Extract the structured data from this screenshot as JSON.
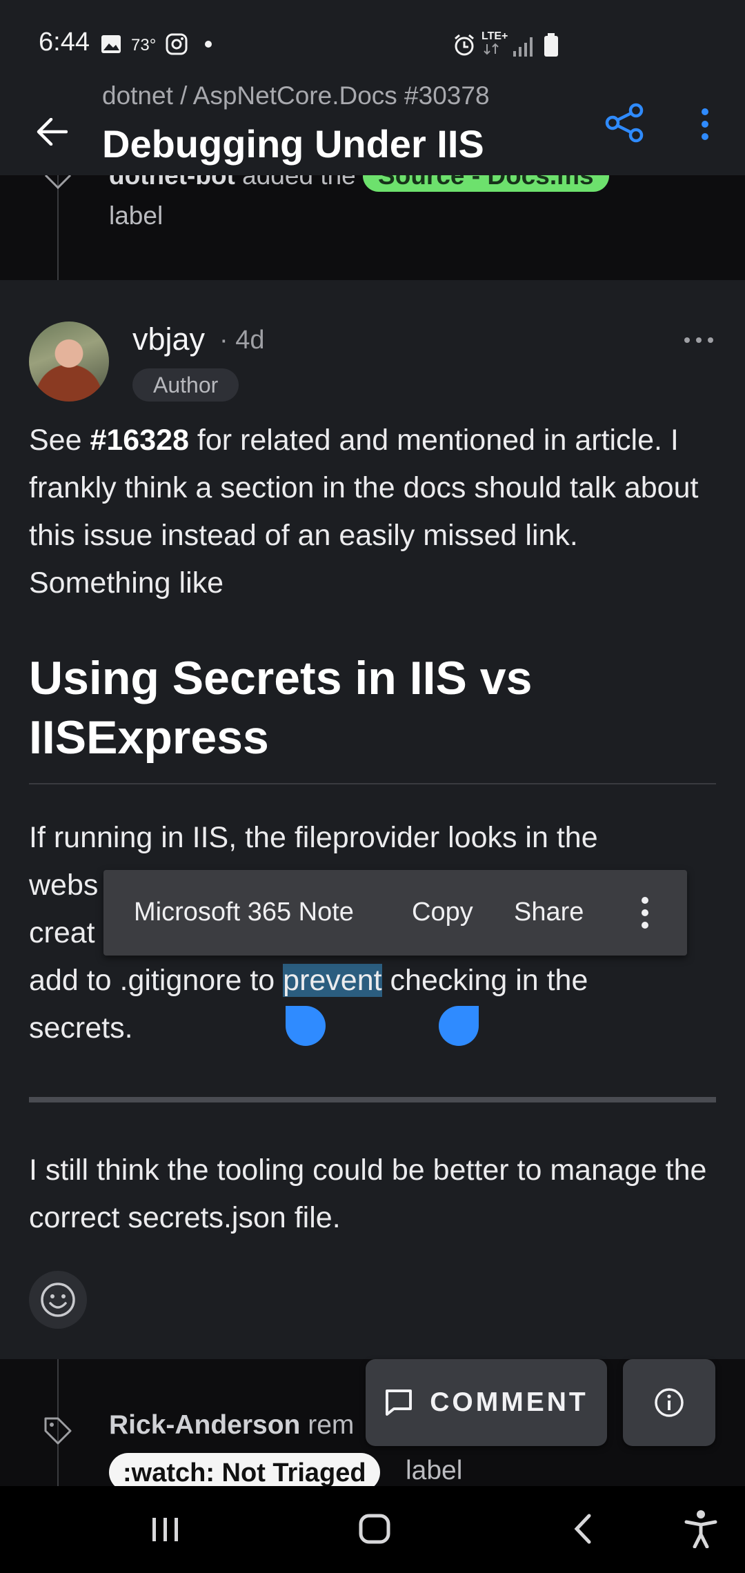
{
  "status_bar": {
    "time": "6:44",
    "temperature": "73°",
    "network": "LTE+"
  },
  "app_bar": {
    "subtitle": "dotnet / AspNetCore.Docs #30378",
    "title": "Debugging Under IIS"
  },
  "event_top": {
    "actor": "dotnet-bot",
    "action": "added the",
    "chip": "Source - Docs.ms",
    "suffix": "label"
  },
  "comment": {
    "author": "vbjay",
    "age": "· 4d",
    "badge": "Author",
    "para1_prefix": "See ",
    "para1_link": "#16328",
    "para1_rest": " for related and mentioned in article. I frankly think a section in the docs should talk about this issue instead of an easily missed link. Something like",
    "heading": "Using Secrets in IIS vs IISExpress",
    "para2_line1": "If running in IIS, the fileprovider looks in the",
    "para2_line2": "webs",
    "para2_line3": "creat",
    "para2_before": "add to .gitignore to ",
    "para2_highlight": "prevent",
    "para2_after": " checking in the",
    "para2_line5": "secrets.",
    "para3": "I still think the tooling could be better to manage the correct secrets.json file."
  },
  "context_menu": {
    "items": [
      "Microsoft 365 Note",
      "Copy",
      "Share"
    ]
  },
  "event_bottom": {
    "actor": "Rick-Anderson",
    "action": "rem",
    "chip": ":watch: Not Triaged",
    "suffix": "label"
  },
  "actions": {
    "comment": "COMMENT"
  },
  "colors": {
    "accent": "#2f8bff",
    "background": "#1c1e22",
    "label_green": "#6de16d"
  },
  "icons": [
    "back-arrow-icon",
    "share-icon",
    "more-vert-icon",
    "more-horiz-icon",
    "smiley-icon",
    "tag-icon",
    "comment-icon",
    "info-icon",
    "recents-icon",
    "home-icon",
    "nav-back-icon",
    "accessibility-icon"
  ]
}
